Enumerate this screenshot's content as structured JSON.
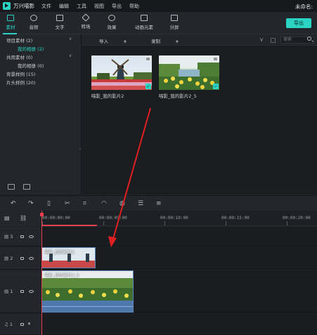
{
  "app": {
    "title": "万兴喵影",
    "menu": [
      "文件",
      "编辑",
      "工具",
      "视图",
      "导出",
      "帮助"
    ],
    "project_name": "未命名:"
  },
  "toolbar": {
    "tools": [
      {
        "label": "素材",
        "active": true
      },
      {
        "label": "音频",
        "active": false
      },
      {
        "label": "文字",
        "active": false
      },
      {
        "label": "转场",
        "active": false
      },
      {
        "label": "效果",
        "active": false
      },
      {
        "label": "动画元素",
        "active": false
      },
      {
        "label": "分屏",
        "active": false
      }
    ],
    "export_label": "导出"
  },
  "library": {
    "items": [
      {
        "label": "项目素材 (2)",
        "sub": false,
        "active": false,
        "caret": "∨"
      },
      {
        "label": "我的相册 (2)",
        "sub": true,
        "active": true,
        "caret": ""
      },
      {
        "label": "共用素材 (0)",
        "sub": false,
        "active": false,
        "caret": "∨"
      },
      {
        "label": "我的相册 (0)",
        "sub": true,
        "active": false,
        "caret": ""
      },
      {
        "label": "背景样例 (15)",
        "sub": false,
        "active": false,
        "caret": ""
      },
      {
        "label": "片头样例 (20)",
        "sub": false,
        "active": false,
        "caret": ""
      }
    ]
  },
  "media": {
    "import_label": "导入",
    "record_label": "录制",
    "search_placeholder": "搜索",
    "items": [
      {
        "label": "喵影_我的影片2",
        "checked": true
      },
      {
        "label": "喵影_我的影片2_5",
        "checked": true
      }
    ]
  },
  "timeline": {
    "ruler": [
      "00:00:00:00",
      "00:00:05:00",
      "00:00:10:00",
      "00:00:15:00",
      "00:00:20:00"
    ],
    "tracks": [
      {
        "label": "3"
      },
      {
        "label": "2"
      },
      {
        "label": "1"
      },
      {
        "label": "1"
      }
    ],
    "clips": [
      {
        "name": "喵影_我的影片2"
      },
      {
        "name": "喵影_我的影片2_5"
      }
    ]
  },
  "colors": {
    "accent": "#2bd3c3",
    "playhead": "#e8414d",
    "annotation_arrow": "#e02020"
  }
}
